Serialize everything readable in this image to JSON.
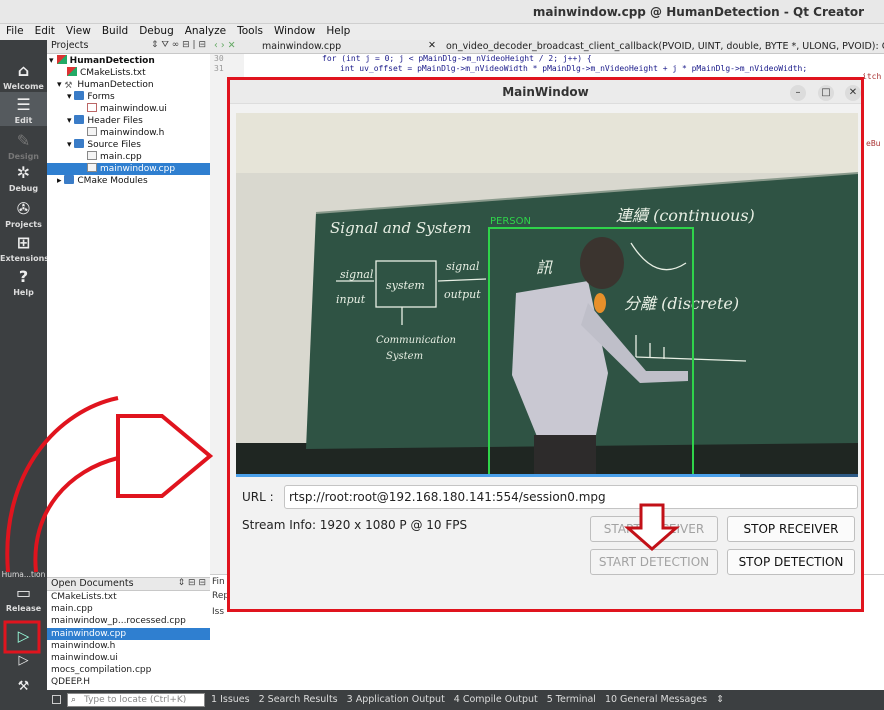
{
  "window": {
    "title": "mainwindow.cpp @ HumanDetection - Qt Creator"
  },
  "menu": [
    "File",
    "Edit",
    "View",
    "Build",
    "Debug",
    "Analyze",
    "Tools",
    "Window",
    "Help"
  ],
  "modes": {
    "welcome": "Welcome",
    "edit": "Edit",
    "design": "Design",
    "debug": "Debug",
    "projects": "Projects",
    "extensions": "Extensions",
    "help": "Help",
    "target_name": "Huma...tion",
    "target_config": "Release"
  },
  "projects_panel": {
    "title": "Projects",
    "tree": {
      "root": "HumanDetection",
      "cmakelists": "CMakeLists.txt",
      "target": "HumanDetection",
      "forms": "Forms",
      "form_file": "mainwindow.ui",
      "headers": "Header Files",
      "header_file": "mainwindow.h",
      "sources": "Source Files",
      "source_main": "main.cpp",
      "source_mainwindow": "mainwindow.cpp",
      "cmake_modules": "CMake Modules"
    }
  },
  "open_documents": {
    "title": "Open Documents",
    "items": [
      "CMakeLists.txt",
      "main.cpp",
      "mainwindow_p...rocessed.cpp",
      "mainwindow.cpp",
      "mainwindow.h",
      "mainwindow.ui",
      "mocs_compilation.cpp",
      "QDEEP.H"
    ]
  },
  "editor": {
    "tab": "mainwindow.cpp",
    "function": "on_video_decoder_broadcast_client_callback(PVOID, UINT, double, BYTE *, ULONG, PVOID): QRETURN",
    "line_numbers": [
      "30",
      "31"
    ],
    "lines": [
      "for (int j = 0; j < pMainDlg->m_nVideoHeight / 2; j++) {",
      "int uv_offset = pMainDlg->m_nVideoWidth * pMainDlg->m_nVideoHeight + j * pMainDlg->m_nVideoWidth;"
    ],
    "fragments": [
      "itch",
      "eBu"
    ]
  },
  "bottom_side_labels": [
    "Fin",
    "Rep",
    "Iss"
  ],
  "statusbar": {
    "locate_placeholder": "Type to locate (Ctrl+K)",
    "panes": [
      "1 Issues",
      "2 Search Results",
      "3 Application Output",
      "4 Compile Output",
      "5 Terminal",
      "10 General Messages"
    ]
  },
  "main_window": {
    "title": "MainWindow",
    "video": {
      "detection_label": "PERSON",
      "board_text": [
        "Signal and System",
        "signal",
        "input",
        "system",
        "signal",
        "output",
        "Communication",
        "System",
        "連續 (continuous)",
        "分離 (discrete)",
        "訊"
      ],
      "progress": 0.81
    },
    "url_label": "URL :",
    "url_value": "rtsp://root:root@192.168.180.141:554/session0.mpg",
    "stream_info": "Stream Info: 1920 x 1080 P  @ 10 FPS",
    "buttons": {
      "start_receiver": "START RECEIVER",
      "stop_receiver": "STOP RECEIVER",
      "start_detection": "START DETECTION",
      "stop_detection": "STOP DETECTION"
    }
  },
  "annotation_colors": {
    "highlight": "#e0141e",
    "arrow": "#c21017"
  }
}
